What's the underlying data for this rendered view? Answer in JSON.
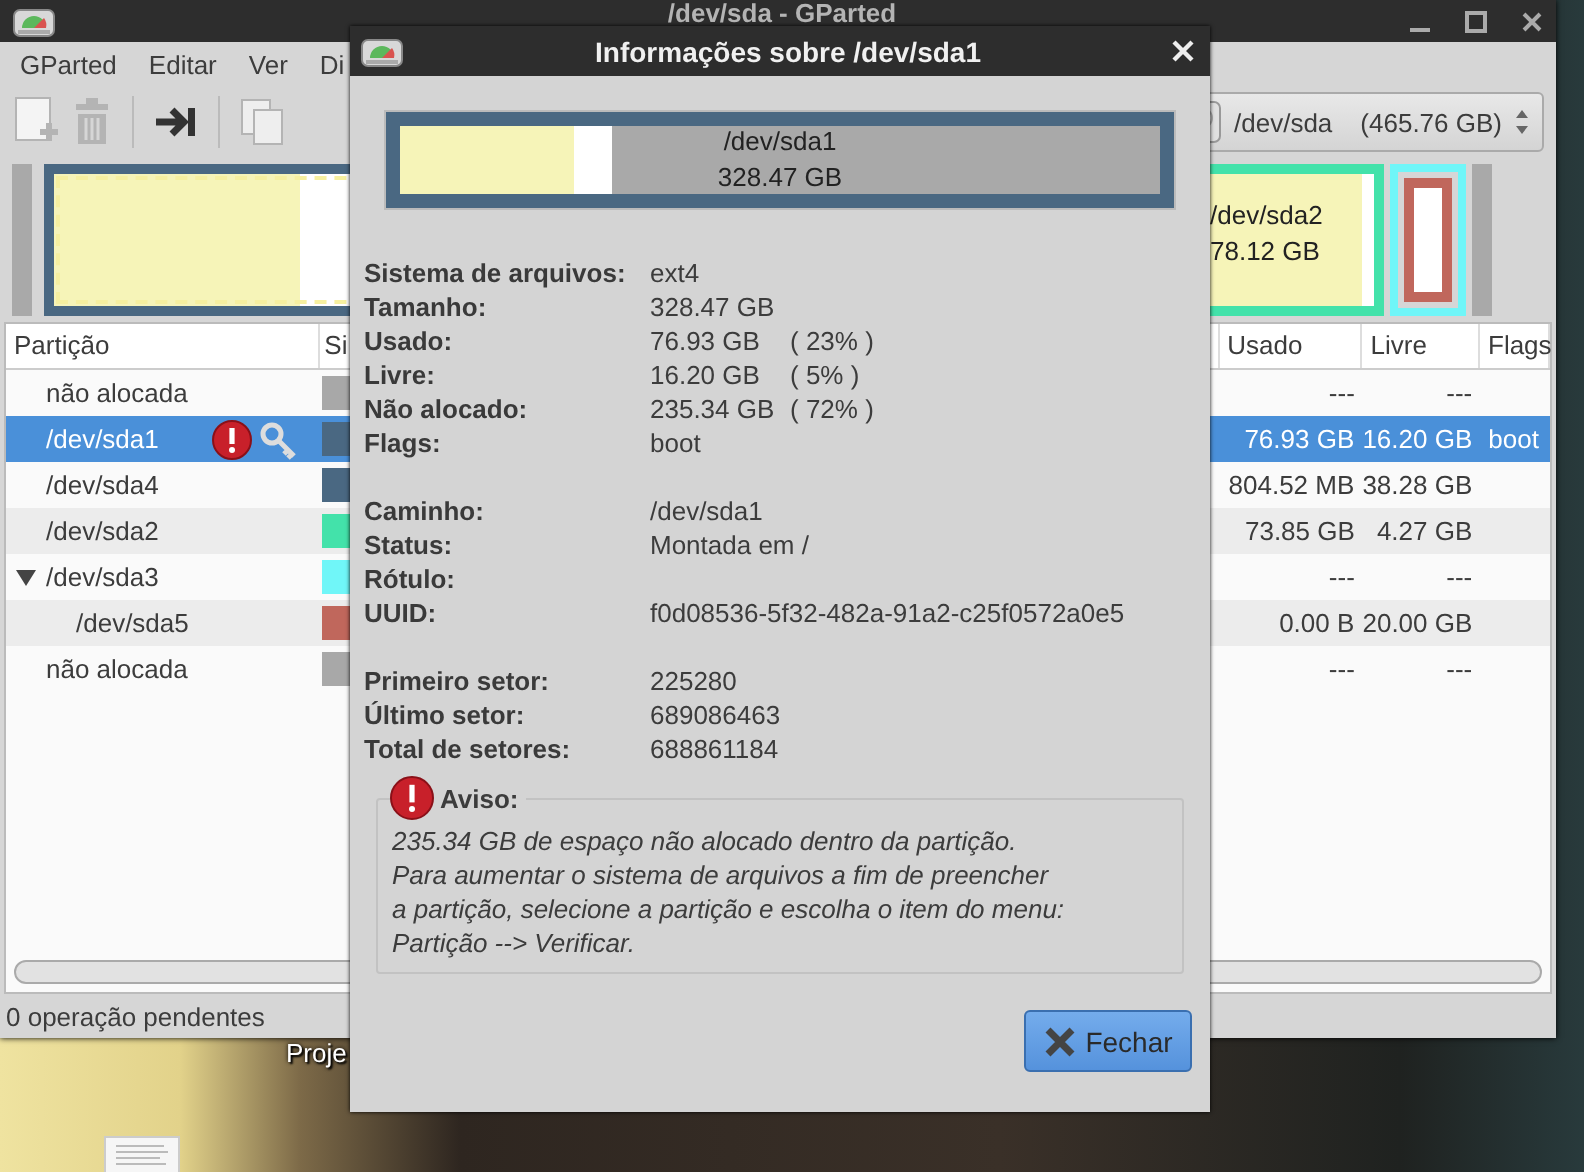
{
  "desktop": {
    "icon_label": "Proje"
  },
  "main_window": {
    "title": "/dev/sda - GParted",
    "menu": [
      "GParted",
      "Editar",
      "Ver",
      "Di"
    ],
    "toolbar": [
      {
        "kind": "new",
        "disabled": true
      },
      {
        "kind": "delete",
        "disabled": true
      },
      {
        "kind": "separator"
      },
      {
        "kind": "apply",
        "disabled": false
      },
      {
        "kind": "separator"
      },
      {
        "kind": "copy",
        "disabled": true
      }
    ],
    "device_selector": {
      "device": "/dev/sda",
      "size": "(465.76 GB)"
    },
    "partition_map": [
      {
        "kind": "unallocated",
        "selected": false
      },
      {
        "kind": "partition",
        "selected": true,
        "color": "#4a6882",
        "filesystem": {
          "level": 0.28
        },
        "used": {
          "level": 0.23
        }
      },
      {
        "kind": "partition",
        "selected": false,
        "color": "#43e2aa",
        "label": "/dev/sda2",
        "size": "78.12 GB",
        "filesystem": {
          "level": 1
        },
        "used": {
          "level": 0.945
        }
      },
      {
        "kind": "extended",
        "selected": false,
        "color": "#70f6f8",
        "children": [
          {
            "kind": "partition",
            "selected": false,
            "color": "#c0675c",
            "filesystem": {
              "level": 1
            }
          }
        ]
      },
      {
        "kind": "unallocated",
        "selected": false
      }
    ],
    "table": {
      "columns": [
        {
          "label": "Partição"
        },
        {
          "label": "Si"
        },
        {
          "label": "Usado"
        },
        {
          "label": "Livre"
        },
        {
          "label": "Flags"
        }
      ],
      "rows": [
        {
          "name": "não alocada",
          "color": "#a8a8a8",
          "used": "---",
          "free": "---",
          "selected": false,
          "warning": false,
          "locked": false
        },
        {
          "name": "/dev/sda1",
          "color": "#4a6882",
          "used": "76.93 GB",
          "free": "16.20 GB",
          "flags": "boot",
          "selected": true,
          "warning": true,
          "locked": true
        },
        {
          "name": "/dev/sda4",
          "color": "#4a6882",
          "used": "804.52 MB",
          "free": "38.28 GB",
          "selected": false,
          "warning": false,
          "locked": false
        },
        {
          "name": "/dev/sda2",
          "color": "#43e2aa",
          "used": "73.85 GB",
          "free": "4.27 GB",
          "selected": false,
          "warning": false,
          "locked": false
        },
        {
          "name": "/dev/sda3",
          "color": "#70f6f8",
          "used": "---",
          "free": "---",
          "selected": false,
          "warning": false,
          "locked": false,
          "expanded": true,
          "children": [
            {
              "name": "/dev/sda5",
              "color": "#c0675c",
              "used": "0.00 B",
              "free": "20.00 GB",
              "selected": false,
              "warning": false,
              "locked": false
            }
          ]
        },
        {
          "name": "não alocada",
          "color": "#a8a8a8",
          "used": "---",
          "free": "---",
          "selected": false,
          "warning": false,
          "locked": false
        }
      ]
    },
    "status_bar": "0 operação pendentes"
  },
  "dialog": {
    "title": "Informações sobre /dev/sda1",
    "graphic": {
      "label": "/dev/sda1",
      "size": "328.47 GB",
      "color": "#4a6882",
      "filesystem": {
        "level": 0.28
      },
      "used": {
        "level": 0.23
      }
    },
    "groups": [
      [
        {
          "label": "Sistema de arquivos:",
          "value": "ext4"
        },
        {
          "label": "Tamanho:",
          "value": "328.47 GB"
        },
        {
          "label": "Usado:",
          "value": "76.93 GB",
          "percent": "( 23% )"
        },
        {
          "label": "Livre:",
          "value": "16.20 GB",
          "percent": "( 5% )"
        },
        {
          "label": "Não alocado:",
          "value": "235.34 GB",
          "percent": "( 72% )"
        },
        {
          "label": "Flags:",
          "value": "boot"
        }
      ],
      [
        {
          "label": "Caminho:",
          "value": "/dev/sda1"
        },
        {
          "label": "Status:",
          "value": "Montada em /"
        },
        {
          "label": "Rótulo:"
        },
        {
          "label": "UUID:",
          "value": "f0d08536-5f32-482a-91a2-c25f0572a0e5"
        }
      ],
      [
        {
          "label": "Primeiro setor:",
          "value": "225280"
        },
        {
          "label": "Último setor:",
          "value": "689086463"
        },
        {
          "label": "Total de setores:",
          "value": "688861184"
        }
      ]
    ],
    "warning": {
      "title": "Aviso:",
      "text": "235.34 GB de espaço não alocado dentro da partição.\nPara aumentar o sistema de arquivos a fim de preencher\na partição, selecione a partição e escolha o item do menu:\nPartição --> Verificar."
    },
    "button": "Fechar"
  }
}
